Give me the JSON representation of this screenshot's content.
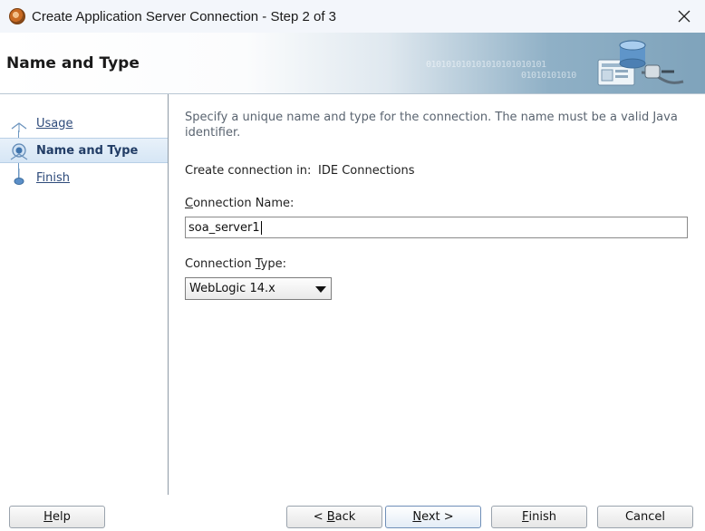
{
  "window": {
    "title": "Create Application Server Connection - Step 2 of 3",
    "close_glyph": "✕"
  },
  "header": {
    "title": "Name and Type",
    "binary_line_1": "010101010101010101010101",
    "binary_line_2": "01010101010"
  },
  "nav": {
    "items": [
      {
        "label": "Usage",
        "state": "visited"
      },
      {
        "label": "Name and Type",
        "state": "current"
      },
      {
        "label": "Finish",
        "state": "pending"
      }
    ]
  },
  "form": {
    "description": "Specify a unique name and type for the connection. The name must be a valid Java identifier.",
    "create_in_label": "Create connection in:",
    "create_in_value": "IDE Connections",
    "connection_name_label_mn": "C",
    "connection_name_label_rest": "onnection Name:",
    "connection_name_value": "soa_server1",
    "connection_type_label_pre": "Connection ",
    "connection_type_label_mn": "T",
    "connection_type_label_post": "ype:",
    "connection_type_value": "WebLogic 14.x"
  },
  "footer": {
    "help_mn": "H",
    "help_rest": "elp",
    "back_pre": "< ",
    "back_mn": "B",
    "back_rest": "ack",
    "next_mn": "N",
    "next_rest": "ext >",
    "finish_mn": "F",
    "finish_rest": "inish",
    "cancel_label": "Cancel"
  },
  "colors": {
    "nav_link": "#2d4a7a",
    "nav_active_bg": "#d6e6f5",
    "banner_accent": "#7fa3bb"
  },
  "icons": {
    "app": "jdeveloper-icon",
    "close": "close-icon",
    "banner": "server-connection-graphic-icon",
    "dropdown": "dropdown-arrow-icon"
  }
}
